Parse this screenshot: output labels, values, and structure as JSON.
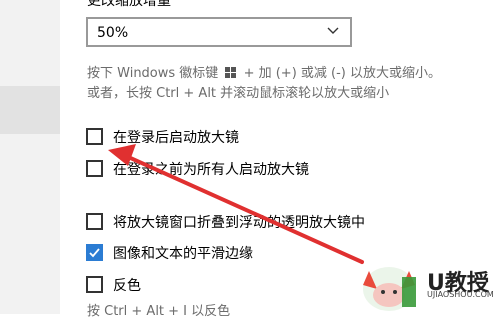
{
  "zoom": {
    "heading": "更改缩放增量",
    "value": "50%"
  },
  "hint": {
    "line1_prefix": "按下 Windows 徽标键",
    "line1_suffix": "+ 加 (+) 或减 (-) 以放大或缩小。",
    "line2": "或者，长按 Ctrl + Alt 并滚动鼠标滚轮以放大或缩小"
  },
  "options": [
    {
      "label": "在登录后启动放大镜",
      "checked": false
    },
    {
      "label": "在登录之前为所有人启动放大镜",
      "checked": false
    },
    {
      "label": "将放大镜窗口折叠到浮动的透明放大镜中",
      "checked": false
    },
    {
      "label": "图像和文本的平滑边缘",
      "checked": true
    },
    {
      "label": "反色",
      "checked": false
    }
  ],
  "invert_hint": "按 Ctrl + Alt + I 以反色",
  "watermark": {
    "text": "U教授",
    "sub": "UJIAOSHOU.COM"
  },
  "colors": {
    "accent": "#2b7cd3",
    "arrow": "#e03030",
    "hint_text": "#6b6b6b"
  }
}
